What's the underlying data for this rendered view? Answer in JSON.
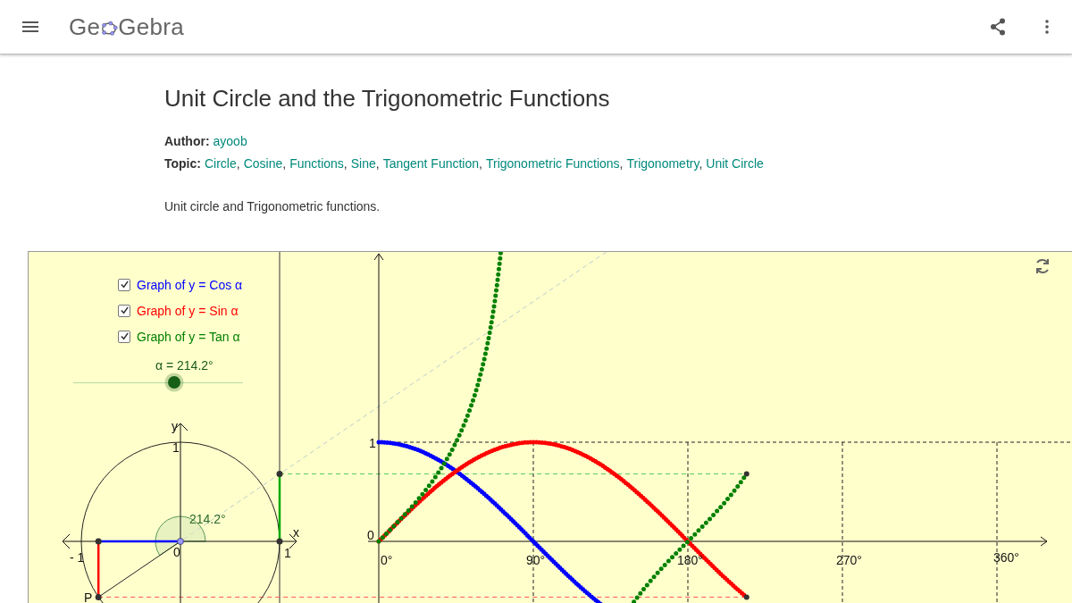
{
  "header": {
    "logo": {
      "before": "Ge",
      "after": "Gebra"
    }
  },
  "article": {
    "title": "Unit Circle and the Trigonometric Functions",
    "author": {
      "label": "Author:",
      "name": "ayoob"
    },
    "topics": {
      "label": "Topic:",
      "separator": ",",
      "items": [
        "Circle",
        "Cosine",
        "Functions",
        "Sine",
        "Tangent Function",
        "Trigonometric Functions",
        "Trigonometry",
        "Unit Circle"
      ]
    },
    "description": "Unit circle and Trigonometric functions."
  },
  "applet": {
    "checkboxes": [
      {
        "label": "Graph of y = Cos α",
        "checked": true,
        "color": "#0000ff"
      },
      {
        "label": "Graph of y = Sin α",
        "checked": true,
        "color": "#ff0000"
      },
      {
        "label": "Graph of y = Tan α",
        "checked": true,
        "color": "#008000"
      }
    ],
    "slider": {
      "label": "α = 214.2°",
      "level": 0.595
    },
    "circle_labels": [
      "y",
      "1",
      "x",
      "0",
      "- 1",
      "1",
      "214.2°",
      "P"
    ],
    "graph_labels": [
      "1",
      "0",
      "0°",
      "90°",
      "180°",
      "270°",
      "360°"
    ]
  }
}
